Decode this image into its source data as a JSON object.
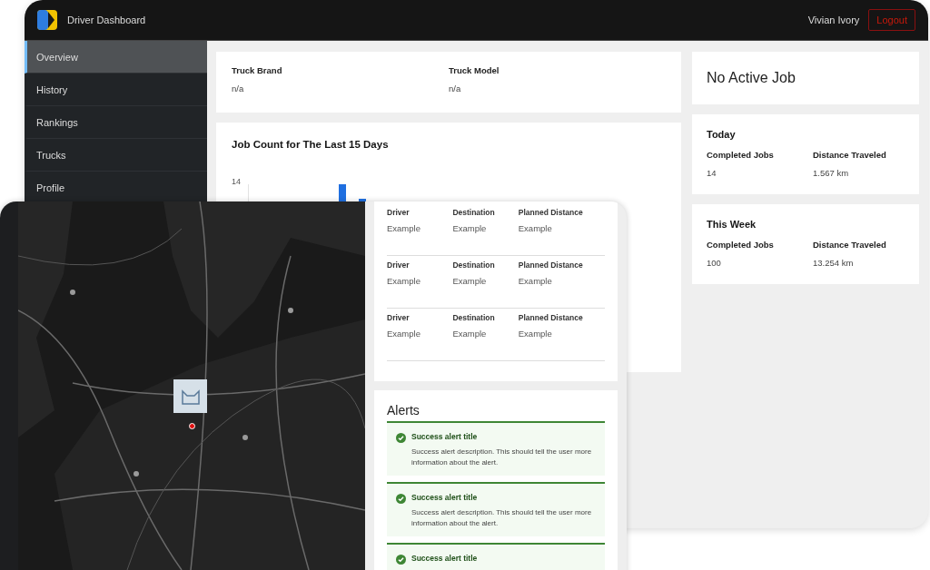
{
  "header": {
    "title": "Driver Dashboard",
    "user": "Vivian Ivory",
    "logout": "Logout"
  },
  "sidebar": {
    "items": [
      {
        "label": "Overview",
        "selected": true
      },
      {
        "label": "History",
        "selected": false
      },
      {
        "label": "Rankings",
        "selected": false
      },
      {
        "label": "Trucks",
        "selected": false
      },
      {
        "label": "Profile",
        "selected": false
      }
    ]
  },
  "truck": [
    {
      "label": "Truck Brand",
      "value": "n/a"
    },
    {
      "label": "Truck Model",
      "value": "n/a"
    }
  ],
  "job_chart": {
    "title": "Job Count for The Last 15 Days",
    "y_tick": "14"
  },
  "active_job": {
    "title": "No Active Job"
  },
  "stats": [
    {
      "title": "Today",
      "items": [
        {
          "label": "Completed Jobs",
          "value": "14"
        },
        {
          "label": "Distance Traveled",
          "value": "1.567 km"
        }
      ]
    },
    {
      "title": "This Week",
      "items": [
        {
          "label": "Completed Jobs",
          "value": "100"
        },
        {
          "label": "Distance Traveled",
          "value": "13.254 km"
        }
      ]
    }
  ],
  "jobs": {
    "rows": [
      {
        "cells": [
          {
            "label": "Driver",
            "value": "Example"
          },
          {
            "label": "Destination",
            "value": "Example"
          },
          {
            "label": "Planned Distance",
            "value": "Example"
          }
        ]
      },
      {
        "cells": [
          {
            "label": "Driver",
            "value": "Example"
          },
          {
            "label": "Destination",
            "value": "Example"
          },
          {
            "label": "Planned Distance",
            "value": "Example"
          }
        ]
      },
      {
        "cells": [
          {
            "label": "Driver",
            "value": "Example"
          },
          {
            "label": "Destination",
            "value": "Example"
          },
          {
            "label": "Planned Distance",
            "value": "Example"
          }
        ]
      }
    ]
  },
  "alerts": {
    "title": "Alerts",
    "items": [
      {
        "kind": "success",
        "title": "Success alert title",
        "description": "Success alert description. This should tell the user more information about the alert."
      },
      {
        "kind": "success",
        "title": "Success alert title",
        "description": "Success alert description. This should tell the user more information about the alert."
      },
      {
        "kind": "success",
        "title": "Success alert title"
      }
    ]
  }
}
